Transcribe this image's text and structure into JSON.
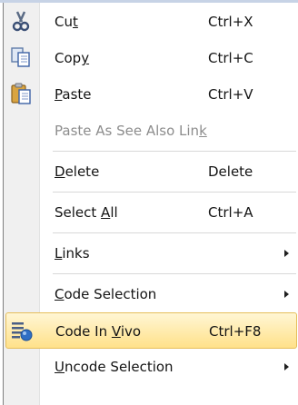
{
  "menu": {
    "items": [
      {
        "pre": "Cu",
        "mnemonic": "t",
        "post": "",
        "shortcut": "Ctrl+X",
        "icon": "scissors-icon",
        "disabled": false,
        "submenu": false
      },
      {
        "pre": "Cop",
        "mnemonic": "y",
        "post": "",
        "shortcut": "Ctrl+C",
        "icon": "copy-icon",
        "disabled": false,
        "submenu": false
      },
      {
        "pre": "",
        "mnemonic": "P",
        "post": "aste",
        "shortcut": "Ctrl+V",
        "icon": "paste-icon",
        "disabled": false,
        "submenu": false
      },
      {
        "pre": "Paste As See Also Lin",
        "mnemonic": "k",
        "post": "",
        "shortcut": "",
        "icon": "",
        "disabled": true,
        "submenu": false
      },
      {
        "pre": "",
        "mnemonic": "D",
        "post": "elete",
        "shortcut": "Delete",
        "icon": "",
        "disabled": false,
        "submenu": false
      },
      {
        "pre": "Select ",
        "mnemonic": "A",
        "post": "ll",
        "shortcut": "Ctrl+A",
        "icon": "",
        "disabled": false,
        "submenu": false
      },
      {
        "pre": "",
        "mnemonic": "L",
        "post": "inks",
        "shortcut": "",
        "icon": "",
        "disabled": false,
        "submenu": true
      },
      {
        "pre": "",
        "mnemonic": "C",
        "post": "ode Selection",
        "shortcut": "",
        "icon": "",
        "disabled": false,
        "submenu": true
      },
      {
        "pre": "Code In ",
        "mnemonic": "V",
        "post": "ivo",
        "shortcut": "Ctrl+F8",
        "icon": "code-in-vivo-icon",
        "disabled": false,
        "submenu": false,
        "highlighted": true
      },
      {
        "pre": "",
        "mnemonic": "U",
        "post": "ncode Selection",
        "shortcut": "",
        "icon": "",
        "disabled": false,
        "submenu": true
      }
    ]
  },
  "colors": {
    "highlight_border": "#e6be5a",
    "highlight_fill": "#ffe18a",
    "disabled_text": "#8d8d8d"
  }
}
